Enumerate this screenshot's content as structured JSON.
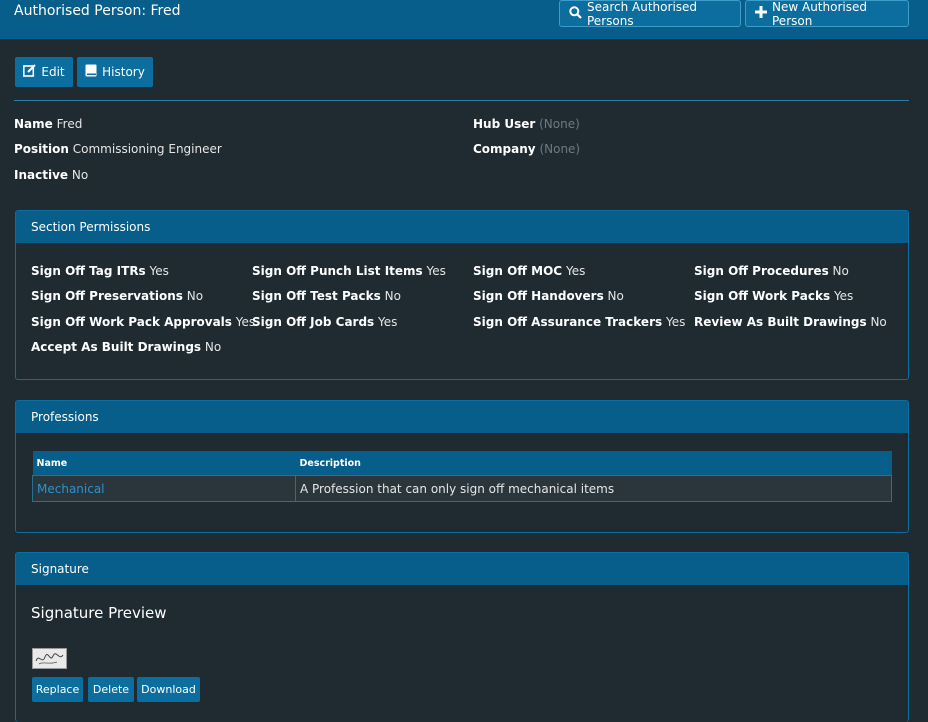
{
  "header": {
    "title": "Authorised Person: Fred",
    "search_button": "Search Authorised Persons",
    "new_button": "New Authorised Person"
  },
  "actions": {
    "edit": "Edit",
    "history": "History"
  },
  "details": {
    "name_label": "Name",
    "name_value": "Fred",
    "position_label": "Position",
    "position_value": "Commissioning Engineer",
    "inactive_label": "Inactive",
    "inactive_value": "No",
    "hub_user_label": "Hub User",
    "hub_user_value": "(None)",
    "company_label": "Company",
    "company_value": "(None)"
  },
  "permissions": {
    "title": "Section Permissions",
    "items": [
      {
        "label": "Sign Off Tag ITRs",
        "value": "Yes"
      },
      {
        "label": "Sign Off Punch List Items",
        "value": "Yes"
      },
      {
        "label": "Sign Off MOC",
        "value": "Yes"
      },
      {
        "label": "Sign Off Procedures",
        "value": "No"
      },
      {
        "label": "Sign Off Preservations",
        "value": "No"
      },
      {
        "label": "Sign Off Test Packs",
        "value": "No"
      },
      {
        "label": "Sign Off Handovers",
        "value": "No"
      },
      {
        "label": "Sign Off Work Packs",
        "value": "Yes"
      },
      {
        "label": "Sign Off Work Pack Approvals",
        "value": "Yes"
      },
      {
        "label": "Sign Off Job Cards",
        "value": "Yes"
      },
      {
        "label": "Sign Off Assurance Trackers",
        "value": "Yes"
      },
      {
        "label": "Review As Built Drawings",
        "value": "No"
      },
      {
        "label": "Accept As Built Drawings",
        "value": "No"
      }
    ]
  },
  "professions": {
    "title": "Professions",
    "columns": [
      "Name",
      "Description"
    ],
    "rows": [
      {
        "name": "Mechanical",
        "description": "A Profession that can only sign off mechanical items"
      }
    ]
  },
  "signature": {
    "title": "Signature",
    "preview_title": "Signature Preview",
    "replace": "Replace",
    "delete": "Delete",
    "download": "Download"
  },
  "colors": {
    "header_bg": "#075e8a",
    "button_bg": "#0b6e9e",
    "page_bg": "#1f2b31",
    "link": "#2a93cc"
  },
  "icons": {
    "search": "search-icon",
    "new": "plus-icon",
    "edit": "edit-icon",
    "history": "book-icon"
  }
}
